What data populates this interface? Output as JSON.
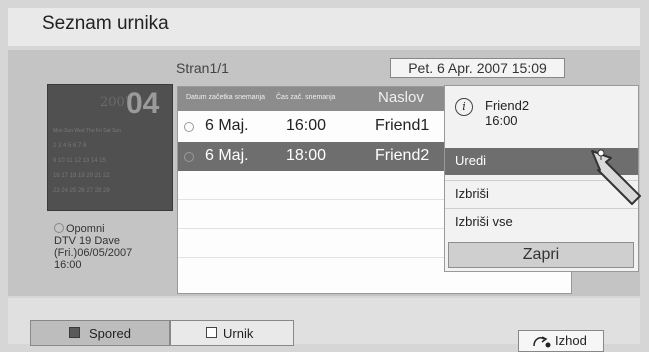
{
  "header": {
    "title": "Seznam urnika"
  },
  "page_indicator": "Stran1/1",
  "current_datetime": "Pet. 6 Apr. 2007 15:09",
  "calendar": {
    "year": "2007",
    "month": "04",
    "weekday_headers": "Mon Sun Wed Thu Fri Sat Sun",
    "weeks": [
      "2  3  4  5  6  7  8",
      "9  10  11  12  13  14  15",
      "16  17  18  19  20  21  22",
      "23  24  25  26  27  28  29"
    ]
  },
  "reminder": {
    "label": "Opomni",
    "channel": "DTV 19 Dave",
    "date": "(Fri.)06/05/2007",
    "time": "16:00"
  },
  "table": {
    "headers": {
      "date": "Datum začetka snemanja",
      "time": "Čas zač. snemanja",
      "title": "Naslov"
    },
    "rows": [
      {
        "date": "6 Maj.",
        "time": "16:00",
        "title": "Friend1"
      },
      {
        "date": "6 Maj.",
        "time": "18:00",
        "title": "Friend2"
      }
    ]
  },
  "popup": {
    "info_icon": "i",
    "program": "Friend2",
    "time": "16:00",
    "items": [
      "Uredi",
      "Izbriši",
      "Izbriši vse"
    ],
    "close_label": "Zapri"
  },
  "footer": {
    "tab1_label": "Spored",
    "tab2_label": "Urnik",
    "exit_label": "Izhod"
  }
}
